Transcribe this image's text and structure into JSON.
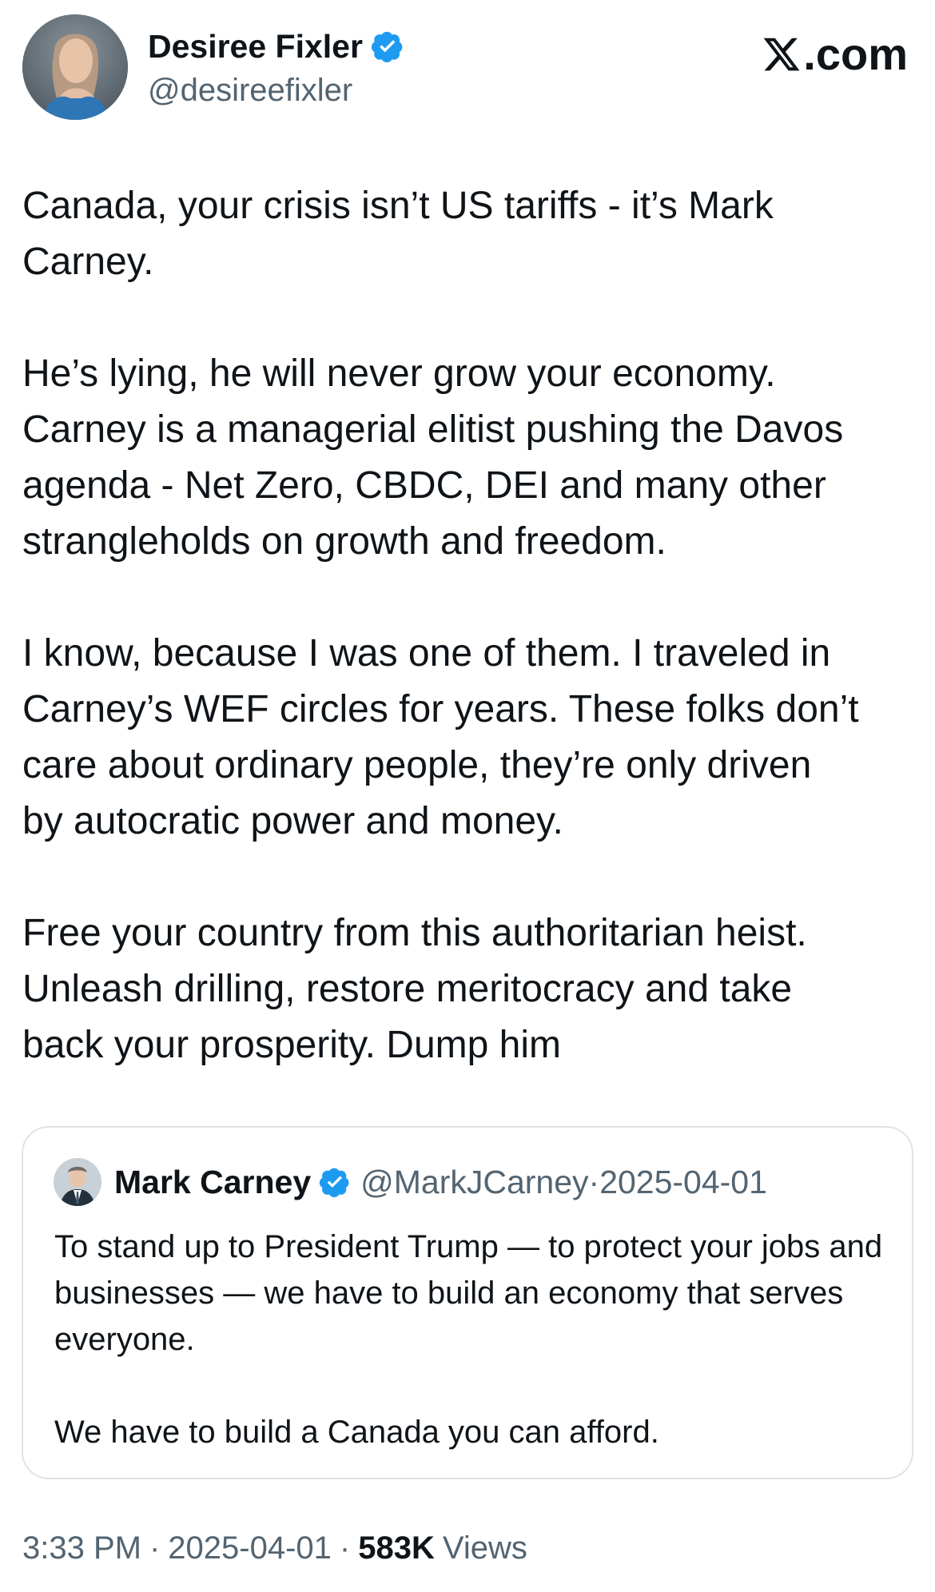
{
  "header": {
    "author_name": "Desiree Fixler",
    "author_handle": "@desireefixler",
    "brand_text": ".com",
    "brand_icon": "x-logo-icon",
    "verified_icon": "verified-badge-icon"
  },
  "tweet": {
    "paragraphs": [
      "Canada, your crisis isn’t US tariffs - it’s Mark\nCarney.",
      "He’s lying, he will never grow your economy.\nCarney is a managerial elitist pushing the Davos\nagenda - Net Zero, CBDC, DEI and many other\nstrangleholds on growth and freedom.",
      "I know, because I was one of them.  I traveled in\nCarney’s WEF circles for years.  These folks don’t\ncare about ordinary people, they’re only driven\nby autocratic power and money.",
      "Free your country from this authoritarian heist.\nUnleash drilling, restore meritocracy and take\nback your prosperity.  Dump him"
    ]
  },
  "quote": {
    "author_name": "Mark Carney",
    "author_handle": "@MarkJCarney",
    "separator": "·",
    "date": "2025-04-01",
    "paragraphs": [
      "To stand up to President Trump — to protect your jobs and businesses — we have to build an economy that serves everyone.",
      "We have to build a Canada you can afford."
    ],
    "verified_icon": "verified-badge-icon"
  },
  "footer": {
    "time": "3:33 PM",
    "separator_1": "·",
    "date": "2025-04-01",
    "separator_2": "·",
    "views_count": "583K",
    "views_label": "Views"
  },
  "colors": {
    "text_primary": "#0f1419",
    "text_secondary": "#536471",
    "verified_blue": "#1d9bf0",
    "border": "#dfe3e7"
  }
}
